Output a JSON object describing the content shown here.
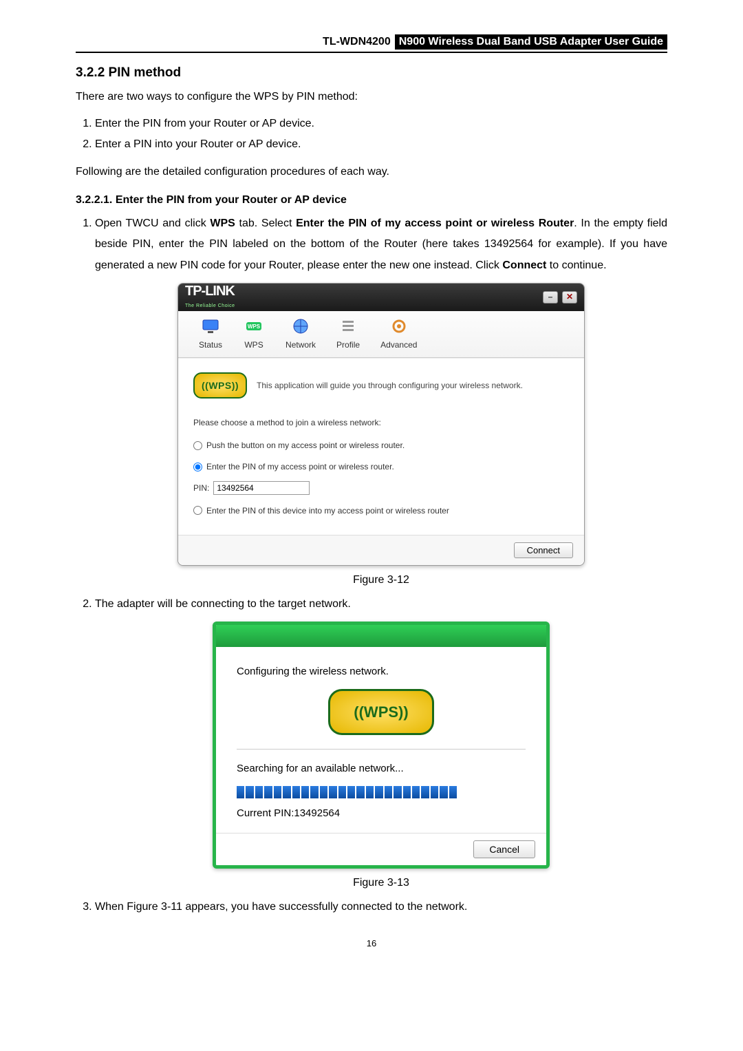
{
  "header": {
    "model": "TL-WDN4200",
    "title": "N900 Wireless Dual Band USB Adapter User Guide"
  },
  "sections": {
    "pin_method": "3.2.2  PIN method",
    "intro": "There are two ways to configure the WPS by PIN method:",
    "way1": "Enter the PIN from your Router or AP device.",
    "way2": "Enter a PIN into your Router or AP device.",
    "following": "Following are the detailed configuration procedures of each way.",
    "sub1": "3.2.2.1.  Enter the PIN from your Router or AP device",
    "step1_a": "Open TWCU and click ",
    "step1_wps": "WPS",
    "step1_b": " tab. Select ",
    "step1_bold2": "Enter the PIN of my access point or wireless Router",
    "step1_c": ". In the empty field beside PIN, enter the PIN labeled on the bottom of the Router (here takes 13492564 for example). If you have generated a new PIN code for your Router, please enter the new one instead. Click ",
    "step1_connect": "Connect",
    "step1_d": " to continue.",
    "fig1": "Figure 3-12",
    "step2": "The adapter will be connecting to the target network.",
    "fig2": "Figure 3-13",
    "step3": "When Figure 3-11 appears, you have successfully connected to the network.",
    "page_number": "16"
  },
  "app": {
    "logo": "TP-LINK",
    "tagline": "The Reliable Choice",
    "minimize": "–",
    "close": "✕",
    "tabs": {
      "status": "Status",
      "wps": "WPS",
      "network": "Network",
      "profile": "Profile",
      "advanced": "Advanced"
    },
    "wps_badge": "((WPS))",
    "guide_text": "This application will guide you through configuring your wireless network.",
    "choose_text": "Please choose a method to join a wireless network:",
    "radio1": "Push the button on my access point or wireless router.",
    "radio2": "Enter the PIN of my access point or wireless router.",
    "pin_label": "PIN:",
    "pin_value": "13492564",
    "radio3": "Enter the PIN of this device into my access point or wireless router",
    "connect_btn": "Connect"
  },
  "dialog": {
    "cfg": "Configuring the wireless network.",
    "wps_badge": "((WPS))",
    "search": "Searching for an available network...",
    "current_pin": "Current PIN:13492564",
    "cancel": "Cancel"
  }
}
